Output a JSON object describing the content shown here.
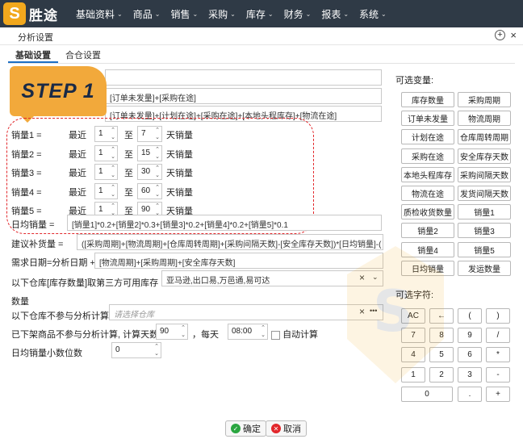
{
  "nav": {
    "logo_glyph": "S",
    "logo_text": "胜途",
    "items": [
      "基础资料",
      "商品",
      "销售",
      "采购",
      "库存",
      "财务",
      "报表",
      "系统"
    ]
  },
  "dialog": {
    "title": "分析设置",
    "pin": "+",
    "close": "×"
  },
  "tabs": [
    "基础设置",
    "合仓设置"
  ],
  "step_badge": "STEP 1",
  "formulas": {
    "row1": "[订单未发量]+[采购在途]",
    "row2": "[订单未发量]+[计划在途]+[采购在途]+[本地头程库存]+[物流在途]"
  },
  "sales": [
    {
      "label": "销量1 =",
      "near": "最近",
      "from": "1",
      "to_label": "至",
      "to": "7",
      "unit": "天销量"
    },
    {
      "label": "销量2 =",
      "near": "最近",
      "from": "1",
      "to_label": "至",
      "to": "15",
      "unit": "天销量"
    },
    {
      "label": "销量3 =",
      "near": "最近",
      "from": "1",
      "to_label": "至",
      "to": "30",
      "unit": "天销量"
    },
    {
      "label": "销量4 =",
      "near": "最近",
      "from": "1",
      "to_label": "至",
      "to": "60",
      "unit": "天销量"
    },
    {
      "label": "销量5 =",
      "near": "最近",
      "from": "1",
      "to_label": "至",
      "to": "90",
      "unit": "天销量"
    }
  ],
  "daily_avg": {
    "label": "日均销量 =",
    "value": "[销量1]*0.2+[销量2]*0.3+[销量3]*0.2+[销量4]*0.2+[销量5]*0.1"
  },
  "suggest": {
    "label": "建议补货量 =",
    "value": "([采购周期]+[物流周期]+[仓库周转周期]+[采购间隔天数]-[安全库存天数])*[日均销量]-("
  },
  "demand": {
    "label": "需求日期=分析日期 +",
    "value": "[物流周期]+[采购周期]+[安全库存天数]"
  },
  "third_party": {
    "label": "以下仓库[库存数量]取第三方可用库存数量",
    "value": "亚马逊,出口易,万邑通,易可达"
  },
  "exclude": {
    "label": "以下仓库不参与分析计算",
    "placeholder": "请选择仓库",
    "more": "•••"
  },
  "removed": {
    "label": "已下架商品不参与分析计算, 计算天数",
    "days": "90",
    "comma": "，每天",
    "time": "08:00",
    "auto_label": "自动计算"
  },
  "decimal": {
    "label": "日均销量小数位数",
    "value": "0"
  },
  "variables_title": "可选变量:",
  "variables": [
    "库存数量",
    "采购周期",
    "订单未发量",
    "物流周期",
    "计划在途",
    "仓库周转周期",
    "采购在途",
    "安全库存天数",
    "本地头程库存",
    "采购间隔天数",
    "物流在途",
    "发货间隔天数",
    "质检收货数量",
    "销量1",
    "销量2",
    "销量3",
    "销量4",
    "销量5",
    "日均销量",
    "发运数量"
  ],
  "chars_title": "可选字符:",
  "chars": [
    "AC",
    "←",
    "(",
    ")",
    "7",
    "8",
    "9",
    "/",
    "4",
    "5",
    "6",
    "*",
    "1",
    "2",
    "3",
    "-",
    "0",
    ".",
    "+"
  ],
  "footer": {
    "ok": "确定",
    "cancel": "取消"
  }
}
